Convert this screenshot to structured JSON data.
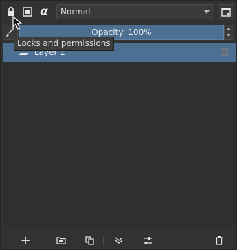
{
  "toolbar": {
    "blend_mode": "Normal",
    "alpha_symbol": "α"
  },
  "opacity": {
    "label": "Opacity: 100%"
  },
  "layers": [
    {
      "name": "Layer 1"
    }
  ],
  "tooltip": {
    "text": "Locks and permissions"
  },
  "bottom_bar": {
    "add_symbol": "+"
  }
}
